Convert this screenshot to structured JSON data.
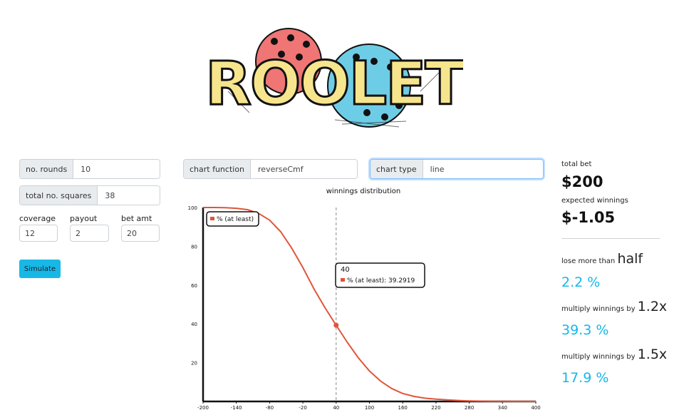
{
  "logo": {
    "text": "ROOLET",
    "colors": {
      "die_left": "#f07575",
      "die_right": "#6ecde6",
      "letters": "#f6e58d",
      "outline": "#111111"
    }
  },
  "controls": {
    "rounds": {
      "label": "no. rounds",
      "value": "10"
    },
    "squares": {
      "label": "total no. squares",
      "value": "38"
    },
    "coverage": {
      "label": "coverage",
      "value": "12"
    },
    "payout": {
      "label": "payout",
      "value": "2"
    },
    "bet_amt": {
      "label": "bet amt",
      "value": "20"
    },
    "simulate_label": "Simulate"
  },
  "chart_options": {
    "function": {
      "label": "chart function",
      "value": "reverseCmf"
    },
    "type": {
      "label": "chart type",
      "value": "line"
    }
  },
  "chart_data": {
    "type": "line",
    "title": "winnings distribution",
    "xlim": [
      -200,
      400
    ],
    "ylim": [
      0,
      100
    ],
    "xticks": [
      -200,
      -140,
      -80,
      -20,
      40,
      100,
      160,
      220,
      280,
      340,
      400
    ],
    "yticks": [
      20,
      40,
      60,
      80,
      100
    ],
    "series": [
      {
        "name": "% (at least)",
        "color": "#e0553a",
        "x": [
          -200,
          -180,
          -160,
          -140,
          -120,
          -100,
          -80,
          -60,
          -40,
          -20,
          0,
          20,
          40,
          60,
          80,
          100,
          120,
          140,
          160,
          180,
          200,
          220,
          240,
          260,
          280,
          300,
          320,
          340,
          360,
          380,
          400
        ],
        "y": [
          100,
          100,
          99.9,
          99.6,
          98.9,
          97,
          93.5,
          87.5,
          79,
          69,
          58,
          48.3,
          39.3,
          30.5,
          22.5,
          15.7,
          10.5,
          6.7,
          4.1,
          2.6,
          1.7,
          1.2,
          0.8,
          0.5,
          0.3,
          0.2,
          0.1,
          0.1,
          0.05,
          0.02,
          0
        ]
      }
    ],
    "legend": {
      "position": "top-left",
      "label": "% (at least)"
    },
    "hover": {
      "x": 40,
      "x_label": "40",
      "text": "% (at least): 39.2919",
      "y": 39.2919
    }
  },
  "stats": {
    "total_bet_label": "total bet",
    "total_bet": "$200",
    "expected_label": "expected winnings",
    "expected": "$-1.05",
    "row1": {
      "prefix": "lose more than",
      "emph": "half",
      "value": "2.2 %"
    },
    "row2": {
      "prefix": "multiply winnings by",
      "emph": "1.2x",
      "value": "39.3 %"
    },
    "row3": {
      "prefix": "multiply winnings by",
      "emph": "1.5x",
      "value": "17.9 %"
    }
  }
}
